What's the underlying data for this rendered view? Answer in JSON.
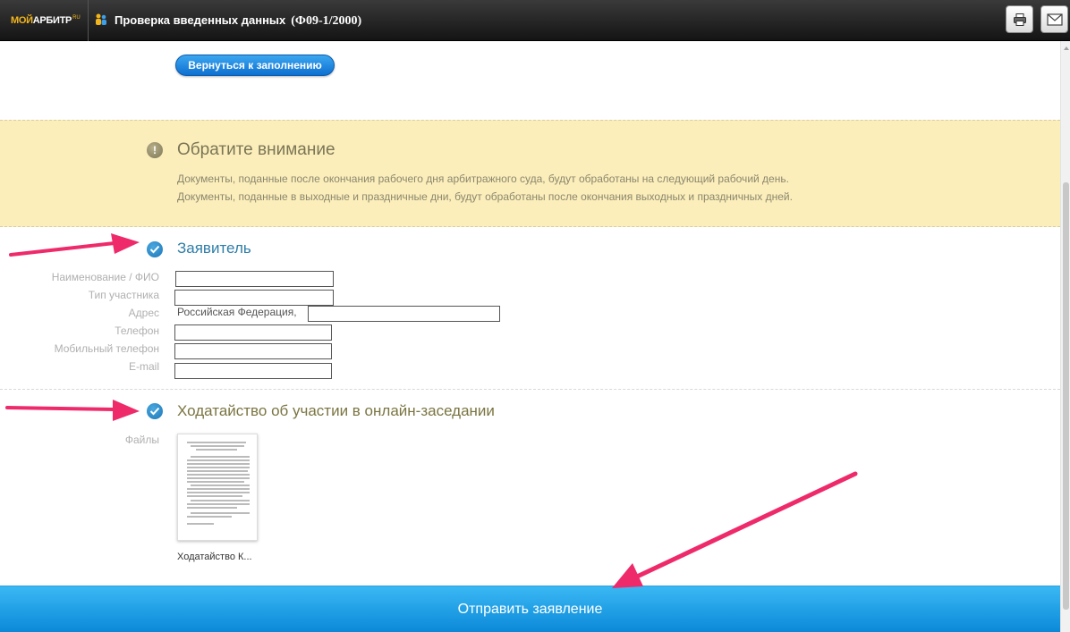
{
  "header": {
    "logo_part1": "МОЙ",
    "logo_part2": "АРБИТР",
    "logo_suffix": "RU",
    "title": "Проверка введенных данных",
    "form_code": "(Ф09-1/2000)",
    "print_icon": "printer-icon",
    "mail_icon": "envelope-icon"
  },
  "back_button": {
    "label": "Вернуться к заполнению"
  },
  "notice": {
    "icon": "exclamation-icon",
    "title": "Обратите внимание",
    "line1": "Документы, поданные после окончания рабочего дня арбитражного суда, будут обработаны на следующий рабочий день.",
    "line2": "Документы, поданные в выходные и праздничные дни, будут обработаны после окончания выходных и праздничных дней."
  },
  "applicant": {
    "title": "Заявитель",
    "fields": [
      {
        "label": "Наименование / ФИО",
        "value": ""
      },
      {
        "label": "Тип участника",
        "value": ""
      },
      {
        "label": "Адрес",
        "prefix": "Российская Федерация,",
        "value": ""
      },
      {
        "label": "Телефон",
        "value": ""
      },
      {
        "label": "Мобильный телефон",
        "value": ""
      },
      {
        "label": "E-mail",
        "value": ""
      }
    ]
  },
  "petition": {
    "title": "Ходатайство об участии в онлайн-заседании",
    "files_label": "Файлы",
    "file_name": "Ходатайство К..."
  },
  "submit": {
    "label": "Отправить заявление"
  },
  "colors": {
    "accent_blue": "#0b89d8",
    "notice_bg": "#fbeebb",
    "arrow": "#ee2a6b"
  }
}
